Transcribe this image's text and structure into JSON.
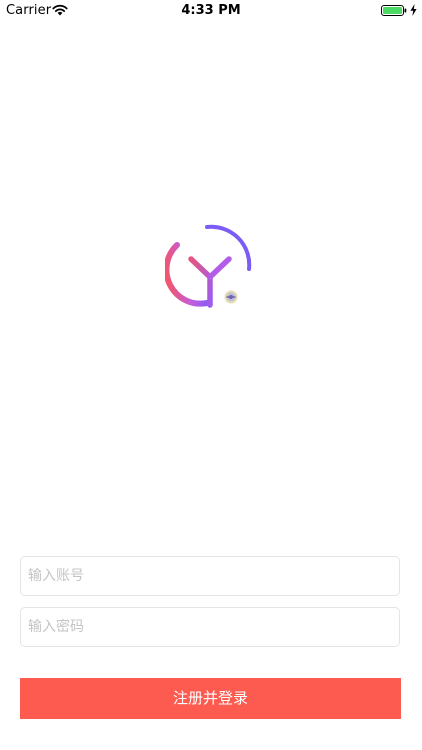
{
  "status_bar": {
    "carrier": "Carrier",
    "time": "4:33 PM",
    "battery_color": "#4cd964"
  },
  "logo": {
    "icon": "yy-logo-icon",
    "gradient_start": "#f2566c",
    "gradient_end": "#7b5cf5"
  },
  "form": {
    "account_placeholder": "输入账号",
    "account_value": "",
    "password_placeholder": "输入密码",
    "password_value": ""
  },
  "register_button": {
    "label": "注册并登录",
    "color": "#fd5b50"
  }
}
